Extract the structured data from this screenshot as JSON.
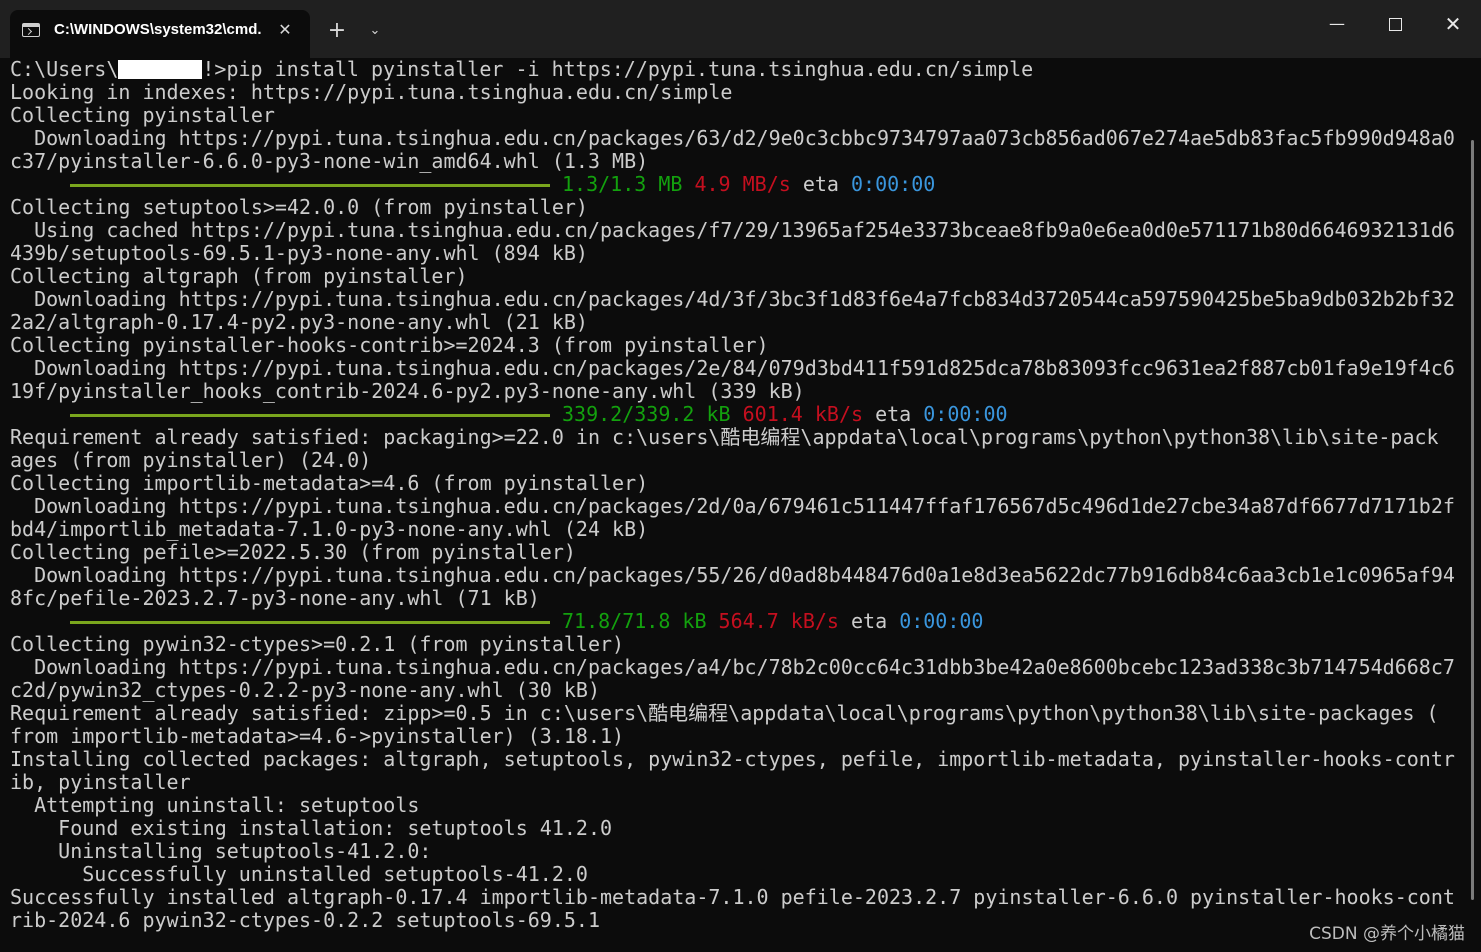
{
  "window": {
    "tab_title": "C:\\WINDOWS\\system32\\cmd.",
    "tab_close": "✕",
    "new_tab": "+",
    "tab_dropdown": "⌄",
    "minimize": "—",
    "close": "✕"
  },
  "terminal": {
    "prompt_prefix": "C:\\Users\\",
    "prompt_suffix": "!>pip install pyinstaller -i https://pypi.tuna.tsinghua.edu.cn/simple",
    "lines": [
      "Looking in indexes: https://pypi.tuna.tsinghua.edu.cn/simple",
      "Collecting pyinstaller",
      "  Downloading https://pypi.tuna.tsinghua.edu.cn/packages/63/d2/9e0c3cbbc9734797aa073cb856ad067e274ae5db83fac5fb990d948a0",
      "c37/pyinstaller-6.6.0-py3-none-win_amd64.whl (1.3 MB)"
    ],
    "progress1": {
      "size": "1.3/1.3 MB",
      "speed": "4.9 MB/s",
      "eta_label": "eta",
      "eta": "0:00:00"
    },
    "lines2": [
      "Collecting setuptools>=42.0.0 (from pyinstaller)",
      "  Using cached https://pypi.tuna.tsinghua.edu.cn/packages/f7/29/13965af254e3373bceae8fb9a0e6ea0d0e571171b80d6646932131d6",
      "439b/setuptools-69.5.1-py3-none-any.whl (894 kB)",
      "Collecting altgraph (from pyinstaller)",
      "  Downloading https://pypi.tuna.tsinghua.edu.cn/packages/4d/3f/3bc3f1d83f6e4a7fcb834d3720544ca597590425be5ba9db032b2bf32",
      "2a2/altgraph-0.17.4-py2.py3-none-any.whl (21 kB)",
      "Collecting pyinstaller-hooks-contrib>=2024.3 (from pyinstaller)",
      "  Downloading https://pypi.tuna.tsinghua.edu.cn/packages/2e/84/079d3bd411f591d825dca78b83093fcc9631ea2f887cb01fa9e19f4c6",
      "19f/pyinstaller_hooks_contrib-2024.6-py2.py3-none-any.whl (339 kB)"
    ],
    "progress2": {
      "size": "339.2/339.2 kB",
      "speed": "601.4 kB/s",
      "eta_label": "eta",
      "eta": "0:00:00"
    },
    "lines3": [
      "Requirement already satisfied: packaging>=22.0 in c:\\users\\酷电编程\\appdata\\local\\programs\\python\\python38\\lib\\site-pack",
      "ages (from pyinstaller) (24.0)",
      "Collecting importlib-metadata>=4.6 (from pyinstaller)",
      "  Downloading https://pypi.tuna.tsinghua.edu.cn/packages/2d/0a/679461c511447ffaf176567d5c496d1de27cbe34a87df6677d7171b2f",
      "bd4/importlib_metadata-7.1.0-py3-none-any.whl (24 kB)",
      "Collecting pefile>=2022.5.30 (from pyinstaller)",
      "  Downloading https://pypi.tuna.tsinghua.edu.cn/packages/55/26/d0ad8b448476d0a1e8d3ea5622dc77b916db84c6aa3cb1e1c0965af94",
      "8fc/pefile-2023.2.7-py3-none-any.whl (71 kB)"
    ],
    "progress3": {
      "size": "71.8/71.8 kB",
      "speed": "564.7 kB/s",
      "eta_label": "eta",
      "eta": "0:00:00"
    },
    "lines4": [
      "Collecting pywin32-ctypes>=0.2.1 (from pyinstaller)",
      "  Downloading https://pypi.tuna.tsinghua.edu.cn/packages/a4/bc/78b2c00cc64c31dbb3be42a0e8600bcebc123ad338c3b714754d668c7",
      "c2d/pywin32_ctypes-0.2.2-py3-none-any.whl (30 kB)",
      "Requirement already satisfied: zipp>=0.5 in c:\\users\\酷电编程\\appdata\\local\\programs\\python\\python38\\lib\\site-packages (",
      "from importlib-metadata>=4.6->pyinstaller) (3.18.1)",
      "Installing collected packages: altgraph, setuptools, pywin32-ctypes, pefile, importlib-metadata, pyinstaller-hooks-contr",
      "ib, pyinstaller",
      "  Attempting uninstall: setuptools",
      "    Found existing installation: setuptools 41.2.0",
      "    Uninstalling setuptools-41.2.0:",
      "      Successfully uninstalled setuptools-41.2.0",
      "Successfully installed altgraph-0.17.4 importlib-metadata-7.1.0 pefile-2023.2.7 pyinstaller-6.6.0 pyinstaller-hooks-cont",
      "rib-2024.6 pywin32-ctypes-0.2.2 setuptools-69.5.1"
    ]
  },
  "watermark": "CSDN @养个小橘猫",
  "colors": {
    "background": "#0c0c0c",
    "text": "#cccccc",
    "progress_bar": "#7aa61d",
    "size_text": "#13a10e",
    "speed_text": "#c50f1f",
    "eta_text": "#3a96dd"
  }
}
